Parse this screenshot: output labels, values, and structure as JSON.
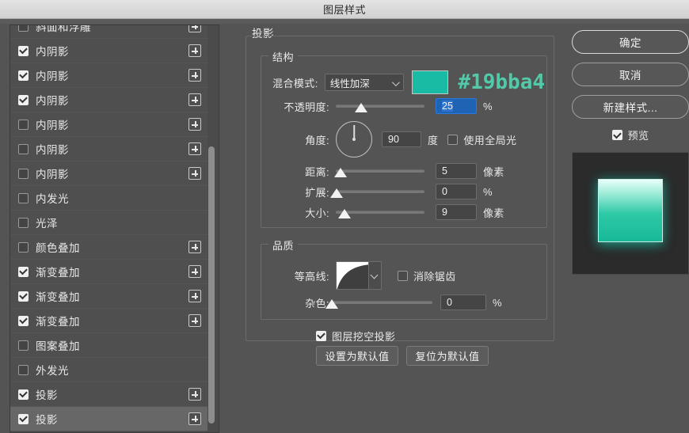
{
  "window": {
    "title": "图层样式"
  },
  "sidebar": {
    "items": [
      {
        "label": "斜面和浮雕",
        "checked": false,
        "plus": true,
        "selected": false,
        "clipped": true
      },
      {
        "label": "内阴影",
        "checked": true,
        "plus": true,
        "selected": false
      },
      {
        "label": "内阴影",
        "checked": true,
        "plus": true,
        "selected": false
      },
      {
        "label": "内阴影",
        "checked": true,
        "plus": true,
        "selected": false
      },
      {
        "label": "内阴影",
        "checked": false,
        "plus": true,
        "selected": false
      },
      {
        "label": "内阴影",
        "checked": false,
        "plus": true,
        "selected": false
      },
      {
        "label": "内阴影",
        "checked": false,
        "plus": true,
        "selected": false
      },
      {
        "label": "内发光",
        "checked": false,
        "plus": false,
        "selected": false
      },
      {
        "label": "光泽",
        "checked": false,
        "plus": false,
        "selected": false
      },
      {
        "label": "颜色叠加",
        "checked": false,
        "plus": true,
        "selected": false
      },
      {
        "label": "渐变叠加",
        "checked": true,
        "plus": true,
        "selected": false
      },
      {
        "label": "渐变叠加",
        "checked": true,
        "plus": true,
        "selected": false
      },
      {
        "label": "渐变叠加",
        "checked": true,
        "plus": true,
        "selected": false
      },
      {
        "label": "图案叠加",
        "checked": false,
        "plus": false,
        "selected": false
      },
      {
        "label": "外发光",
        "checked": false,
        "plus": false,
        "selected": false
      },
      {
        "label": "投影",
        "checked": true,
        "plus": true,
        "selected": false
      },
      {
        "label": "投影",
        "checked": true,
        "plus": true,
        "selected": true
      }
    ]
  },
  "main": {
    "panel_title": "投影",
    "structure": {
      "legend": "结构",
      "blend_mode_label": "混合模式:",
      "blend_mode_value": "线性加深",
      "color_hex": "#19bba4",
      "color_swatch": "#19bba4",
      "opacity_label": "不透明度:",
      "opacity_value": "25",
      "opacity_unit": "%",
      "angle_label": "角度:",
      "angle_value": "90",
      "angle_unit": "度",
      "global_light_label": "使用全局光",
      "global_light_checked": false,
      "distance_label": "距离:",
      "distance_value": "5",
      "distance_unit": "像素",
      "spread_label": "扩展:",
      "spread_value": "0",
      "spread_unit": "%",
      "size_label": "大小:",
      "size_value": "9",
      "size_unit": "像素"
    },
    "quality": {
      "legend": "品质",
      "contour_label": "等高线:",
      "antialias_label": "消除锯齿",
      "antialias_checked": false,
      "noise_label": "杂色:",
      "noise_value": "0",
      "noise_unit": "%"
    },
    "knockout_label": "图层挖空投影",
    "knockout_checked": true,
    "make_default_label": "设置为默认值",
    "reset_default_label": "复位为默认值"
  },
  "right": {
    "ok_label": "确定",
    "cancel_label": "取消",
    "new_style_label": "新建样式...",
    "preview_label": "预览",
    "preview_checked": true
  }
}
